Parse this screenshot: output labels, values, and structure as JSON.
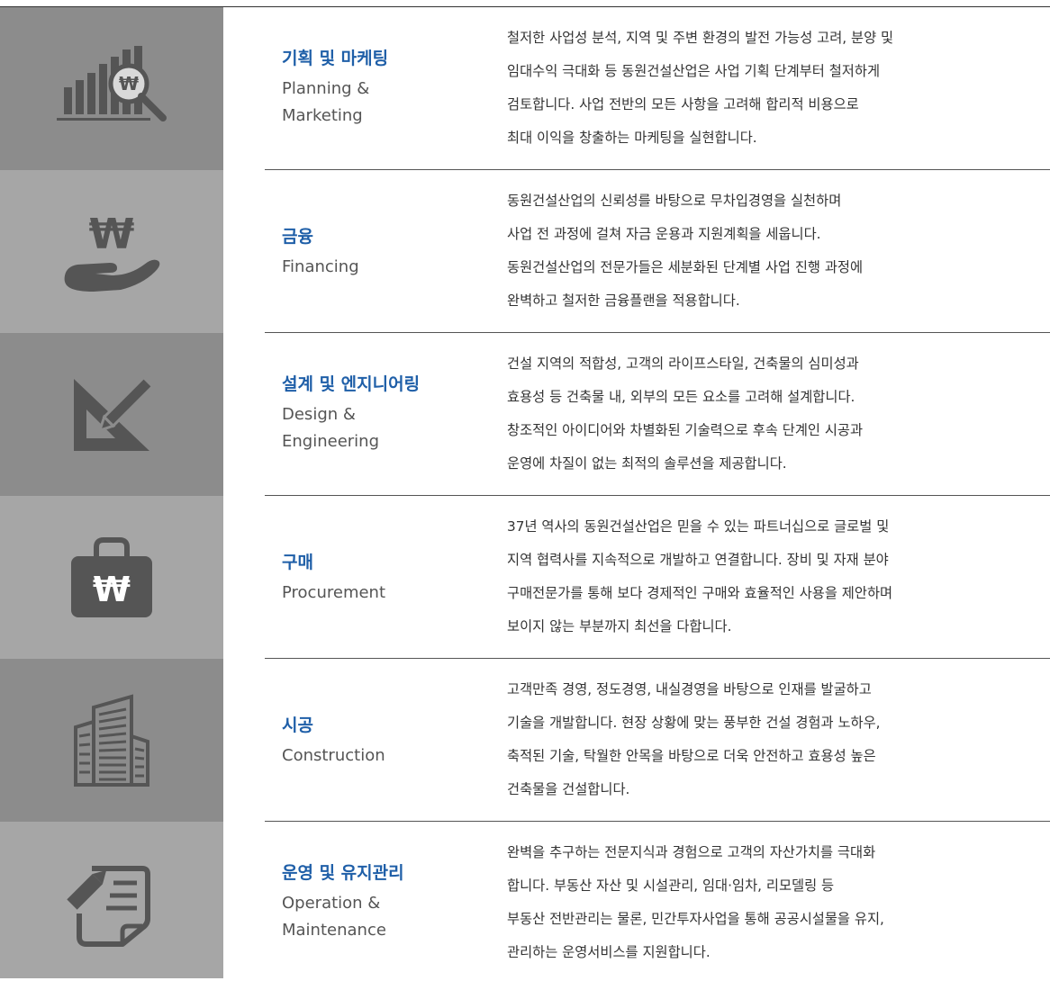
{
  "services": [
    {
      "icon": "chart-magnifier-icon",
      "title_ko": "기획 및 마케팅",
      "title_en": "Planning & Marketing",
      "title_en_lines": [
        "Planning &",
        "Marketing"
      ],
      "desc": [
        "철저한 사업성 분석, 지역 및 주변 환경의 발전 가능성 고려, 분양 및",
        "임대수익 극대화 등 동원건설산업은 사업 기획 단계부터 철저하게",
        "검토합니다. 사업 전반의 모든 사항을 고려해 합리적 비용으로",
        "최대 이익을 창출하는 마케팅을 실현합니다."
      ]
    },
    {
      "icon": "won-hand-icon",
      "title_ko": "금융",
      "title_en": "Financing",
      "title_en_lines": [
        "Financing"
      ],
      "desc": [
        "동원건설산업의 신뢰성를 바탕으로 무차입경영을 실천하며",
        "사업 전 과정에 걸쳐 자금 운용과 지원계획을 세웁니다.",
        "동원건설산업의 전문가들은 세분화된 단계별 사업 진행 과정에",
        "완벽하고 철저한 금융플랜을 적용합니다."
      ]
    },
    {
      "icon": "triangle-ruler-pencil-icon",
      "title_ko": "설계 및 엔지니어링",
      "title_en": "Design & Engineering",
      "title_en_lines": [
        "Design &",
        "Engineering"
      ],
      "desc": [
        "건설 지역의 적합성, 고객의 라이프스타일, 건축물의 심미성과",
        "효용성 등 건축물 내, 외부의 모든 요소를 고려해 설계합니다.",
        "창조적인 아이디어와 차별화된 기술력으로 후속 단계인 시공과",
        "운영에 차질이 없는 최적의 솔루션을 제공합니다."
      ]
    },
    {
      "icon": "won-bag-icon",
      "title_ko": "구매",
      "title_en": "Procurement",
      "title_en_lines": [
        "Procurement"
      ],
      "desc": [
        "37년 역사의 동원건설산업은 믿을 수 있는 파트너십으로 글로벌 및",
        "지역 협력사를 지속적으로 개발하고 연결합니다. 장비 및 자재 분야",
        "구매전문가를 통해 보다 경제적인 구매와 효율적인 사용을 제안하며",
        "보이지 않는 부분까지 최선을 다합니다."
      ]
    },
    {
      "icon": "buildings-icon",
      "title_ko": "시공",
      "title_en": "Construction",
      "title_en_lines": [
        "Construction"
      ],
      "desc": [
        "고객만족 경영, 정도경영, 내실경영을 바탕으로 인재를 발굴하고",
        "기술을 개발합니다. 현장 상황에 맞는 풍부한 건설 경험과 노하우,",
        "축적된 기술, 탁월한 안목을 바탕으로 더욱 안전하고 효용성 높은",
        "건축물을 건설합니다."
      ]
    },
    {
      "icon": "document-pen-icon",
      "title_ko": "운영 및 유지관리",
      "title_en": "Operation & Maintenance",
      "title_en_lines": [
        "Operation &",
        "Maintenance"
      ],
      "desc": [
        "완벽을 추구하는 전문지식과 경험으로 고객의 자산가치를 극대화",
        "합니다. 부동산 자산 및 시설관리, 임대·임차, 리모델링 등",
        "부동산 전반관리는 물론, 민간투자사업을 통해 공공시설물을 유지,",
        "관리하는 운영서비스를 지원합니다."
      ]
    }
  ],
  "colors": {
    "icon_bg_dark": "#8c8c8c",
    "icon_bg_light": "#a6a6a6",
    "icon_fill": "#555555",
    "title_ko": "#1f5fa8",
    "divider": "#555555"
  }
}
